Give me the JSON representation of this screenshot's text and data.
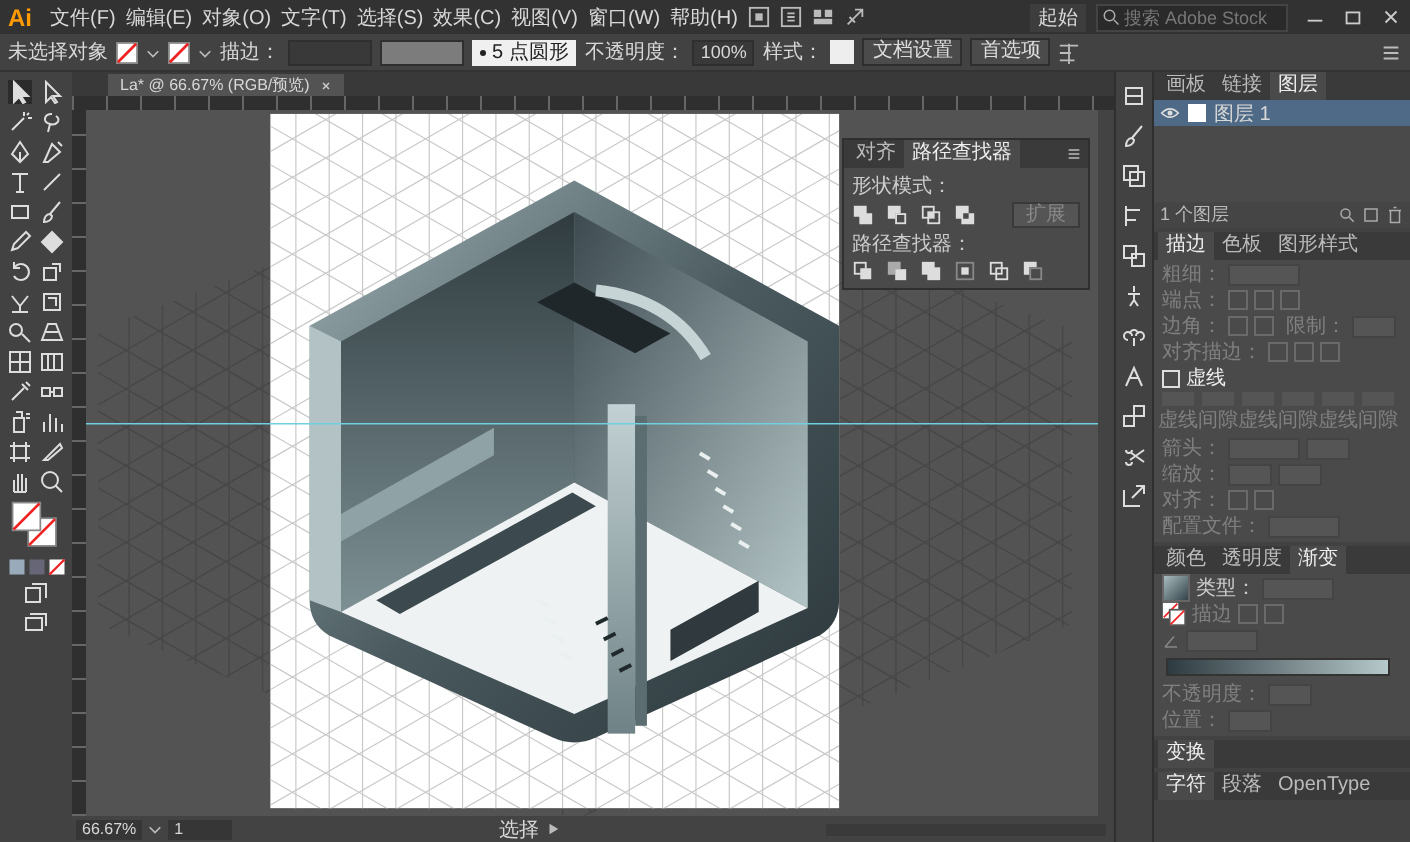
{
  "menu_bar": {
    "logo": "Ai",
    "menus": [
      "文件(F)",
      "编辑(E)",
      "对象(O)",
      "文字(T)",
      "选择(S)",
      "效果(C)",
      "视图(V)",
      "窗口(W)",
      "帮助(H)"
    ],
    "workspace": "起始",
    "search": {
      "placeholder": "搜索 Adobe Stock"
    }
  },
  "control_bar": {
    "selection": "未选择对象",
    "stroke_label": "描边：",
    "brush": "5 点圆形",
    "opacity_label": "不透明度：",
    "opacity": "100%",
    "style_label": "样式：",
    "buttons": [
      "文档设置",
      "首选项"
    ]
  },
  "document_tab": {
    "title": "La* @ 66.67% (RGB/预览)"
  },
  "pathfinder_panel": {
    "tabs": [
      {
        "label": "对齐",
        "selected": false
      },
      {
        "label": "路径查找器",
        "selected": true
      }
    ],
    "shape_modes_label": "形状模式：",
    "expand_button": "扩展",
    "pathfinders_label": "路径查找器："
  },
  "layers_panel": {
    "tabs": [
      {
        "label": "画板",
        "selected": false
      },
      {
        "label": "链接",
        "selected": false
      },
      {
        "label": "图层",
        "selected": true
      }
    ],
    "layers": [
      {
        "name": "图层 1",
        "selected": true
      }
    ],
    "count": "1 个图层"
  },
  "stroke_panel": {
    "tabs": [
      {
        "label": "描边",
        "selected": true
      },
      {
        "label": "色板",
        "selected": false
      },
      {
        "label": "图形样式",
        "selected": false
      }
    ],
    "disabled": true,
    "weight_label": "粗细：",
    "cap_label": "端点：",
    "corner_label": "边角：",
    "limit_label": "限制：",
    "align_label": "对齐描边：",
    "dashed": {
      "label": "虚线",
      "checked": false
    },
    "dash_fields": [
      "虚线",
      "间隙",
      "虚线",
      "间隙",
      "虚线",
      "间隙"
    ],
    "arrowheads_label": "箭头：",
    "scale_label": "缩放：",
    "arrow_align_label": "对齐：",
    "profile_label": "配置文件："
  },
  "gradient_panel": {
    "tabs": [
      {
        "label": "颜色",
        "selected": false
      },
      {
        "label": "透明度",
        "selected": false
      },
      {
        "label": "渐变",
        "selected": true
      }
    ],
    "type_label": "类型：",
    "stroke_label": "描边",
    "opacity_label": "不透明度：",
    "location_label": "位置："
  },
  "collapsed_panels": [
    {
      "tabs": [
        {
          "label": "变换",
          "selected": true
        }
      ]
    },
    {
      "tabs": [
        {
          "label": "字符",
          "selected": true
        },
        {
          "label": "段落",
          "selected": false
        },
        {
          "label": "OpenType",
          "selected": false
        }
      ]
    }
  ],
  "status_bar": {
    "zoom": "66.67%",
    "artboard": "1",
    "tool": "选择"
  }
}
